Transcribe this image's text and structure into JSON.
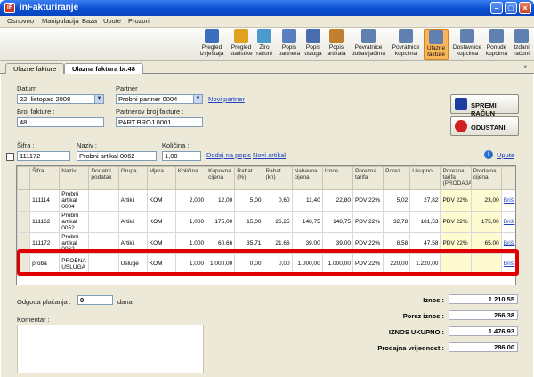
{
  "window": {
    "title": "inFakturiranje",
    "icon_text": "iF"
  },
  "menu": [
    "Osnovno",
    "Manipulacija",
    "Baza",
    "Upute",
    "Prozori"
  ],
  "toolbar": [
    {
      "label": "Pregled izvještaja",
      "color": "#3a6fc0"
    },
    {
      "label": "Pregled statistike",
      "color": "#e0a020"
    },
    {
      "label": "Žiro računi",
      "color": "#4a9ad0"
    },
    {
      "label": "Popis partnera",
      "color": "#5a7ec0"
    },
    {
      "label": "Popis usluga",
      "color": "#4a6cb0"
    },
    {
      "label": "Popis artikala",
      "color": "#c08030"
    },
    {
      "label": "Povratnice dobavljačima",
      "color": "#6080b0"
    },
    {
      "label": "Povratnice kupcima",
      "color": "#6080b0"
    },
    {
      "label": "Ulazne fakture",
      "color": "#6080b0"
    },
    {
      "label": "Dostavnice kupcima",
      "color": "#6080b0"
    },
    {
      "label": "Ponude kupcima",
      "color": "#6080b0"
    },
    {
      "label": "Izdani računi",
      "color": "#6080b0"
    }
  ],
  "tabs": [
    "Ulazne fakture",
    "Ulazna faktura br.48"
  ],
  "form": {
    "datum_label": "Datum",
    "datum_value": "22. listopad 2008",
    "partner_label": "Partner",
    "partner_value": "Probni partner 0004",
    "novi_partner": "Novi partner",
    "broj_label": "Broj fakture :",
    "broj_value": "48",
    "pbroj_label": "Partnerov broj fakture :",
    "pbroj_value": "PART.BROJ 0001",
    "sifra_label": "Šifra :",
    "sifra_value": "111172",
    "naziv_label": "Naziv :",
    "naziv_value": "Probni artikal 0062",
    "kolicina_label": "Količina :",
    "kolicina_value": "1,00",
    "dodaj_popis": "Dodaj na popis",
    "novi_artikal": "Novi artikal",
    "upute": "Upute",
    "spremi": "SPREMI RAČUN",
    "odustani": "ODUSTANI"
  },
  "grid": {
    "headers": [
      "Šifra",
      "Naziv",
      "Dodatni podatak",
      "Grupa",
      "Mjera",
      "Količina",
      "Kupovna cijena",
      "Rabat (%)",
      "Rabat (kn)",
      "Nabavna cijena",
      "Iznos",
      "Porezna tarifa",
      "Porez",
      "Ukupno",
      "Porezna tarifa (PRODAJA)",
      "Prodajna cijena",
      ""
    ],
    "rows": [
      [
        "111114",
        "Probni artikal 0004",
        "",
        "Artikli",
        "KOM",
        "2,000",
        "12,00",
        "5,00",
        "0,60",
        "11,40",
        "22,80",
        "PDV 22%",
        "5,02",
        "27,82",
        "PDV 22%",
        "23,00",
        "Briši"
      ],
      [
        "111162",
        "Probni artikal 0052",
        "",
        "Artikli",
        "KOM",
        "1,000",
        "175,00",
        "15,00",
        "26,25",
        "148,75",
        "148,75",
        "PDV 22%",
        "32,78",
        "181,53",
        "PDV 22%",
        "175,00",
        "Briši"
      ],
      [
        "111172",
        "Probni artikal 0062",
        "",
        "Artikli",
        "KOM",
        "1,000",
        "60,66",
        "35,71",
        "21,66",
        "39,00",
        "39,00",
        "PDV 22%",
        "8,58",
        "47,58",
        "PDV 22%",
        "65,00",
        "Briši"
      ],
      [
        "proba",
        "PROBNA USLUGA",
        "",
        "Usluge",
        "KOM",
        "1,000",
        "1.000,00",
        "0,00",
        "0,00",
        "1.000,00",
        "1.000,00",
        "PDV 22%",
        "220,00",
        "1.220,00",
        "",
        "",
        "Briši"
      ]
    ]
  },
  "odgoda": {
    "label": "Odgoda plaćanja :",
    "value": "0",
    "suffix": "dana."
  },
  "komentar_label": "Komentar :",
  "totals": [
    {
      "label": "Iznos :",
      "value": "1.210,55"
    },
    {
      "label": "Porez iznos :",
      "value": "266,38"
    },
    {
      "label": "IZNOS UKUPNO :",
      "value": "1.476,93"
    },
    {
      "label": "Prodajna vrijednost :",
      "value": "286,00"
    }
  ]
}
